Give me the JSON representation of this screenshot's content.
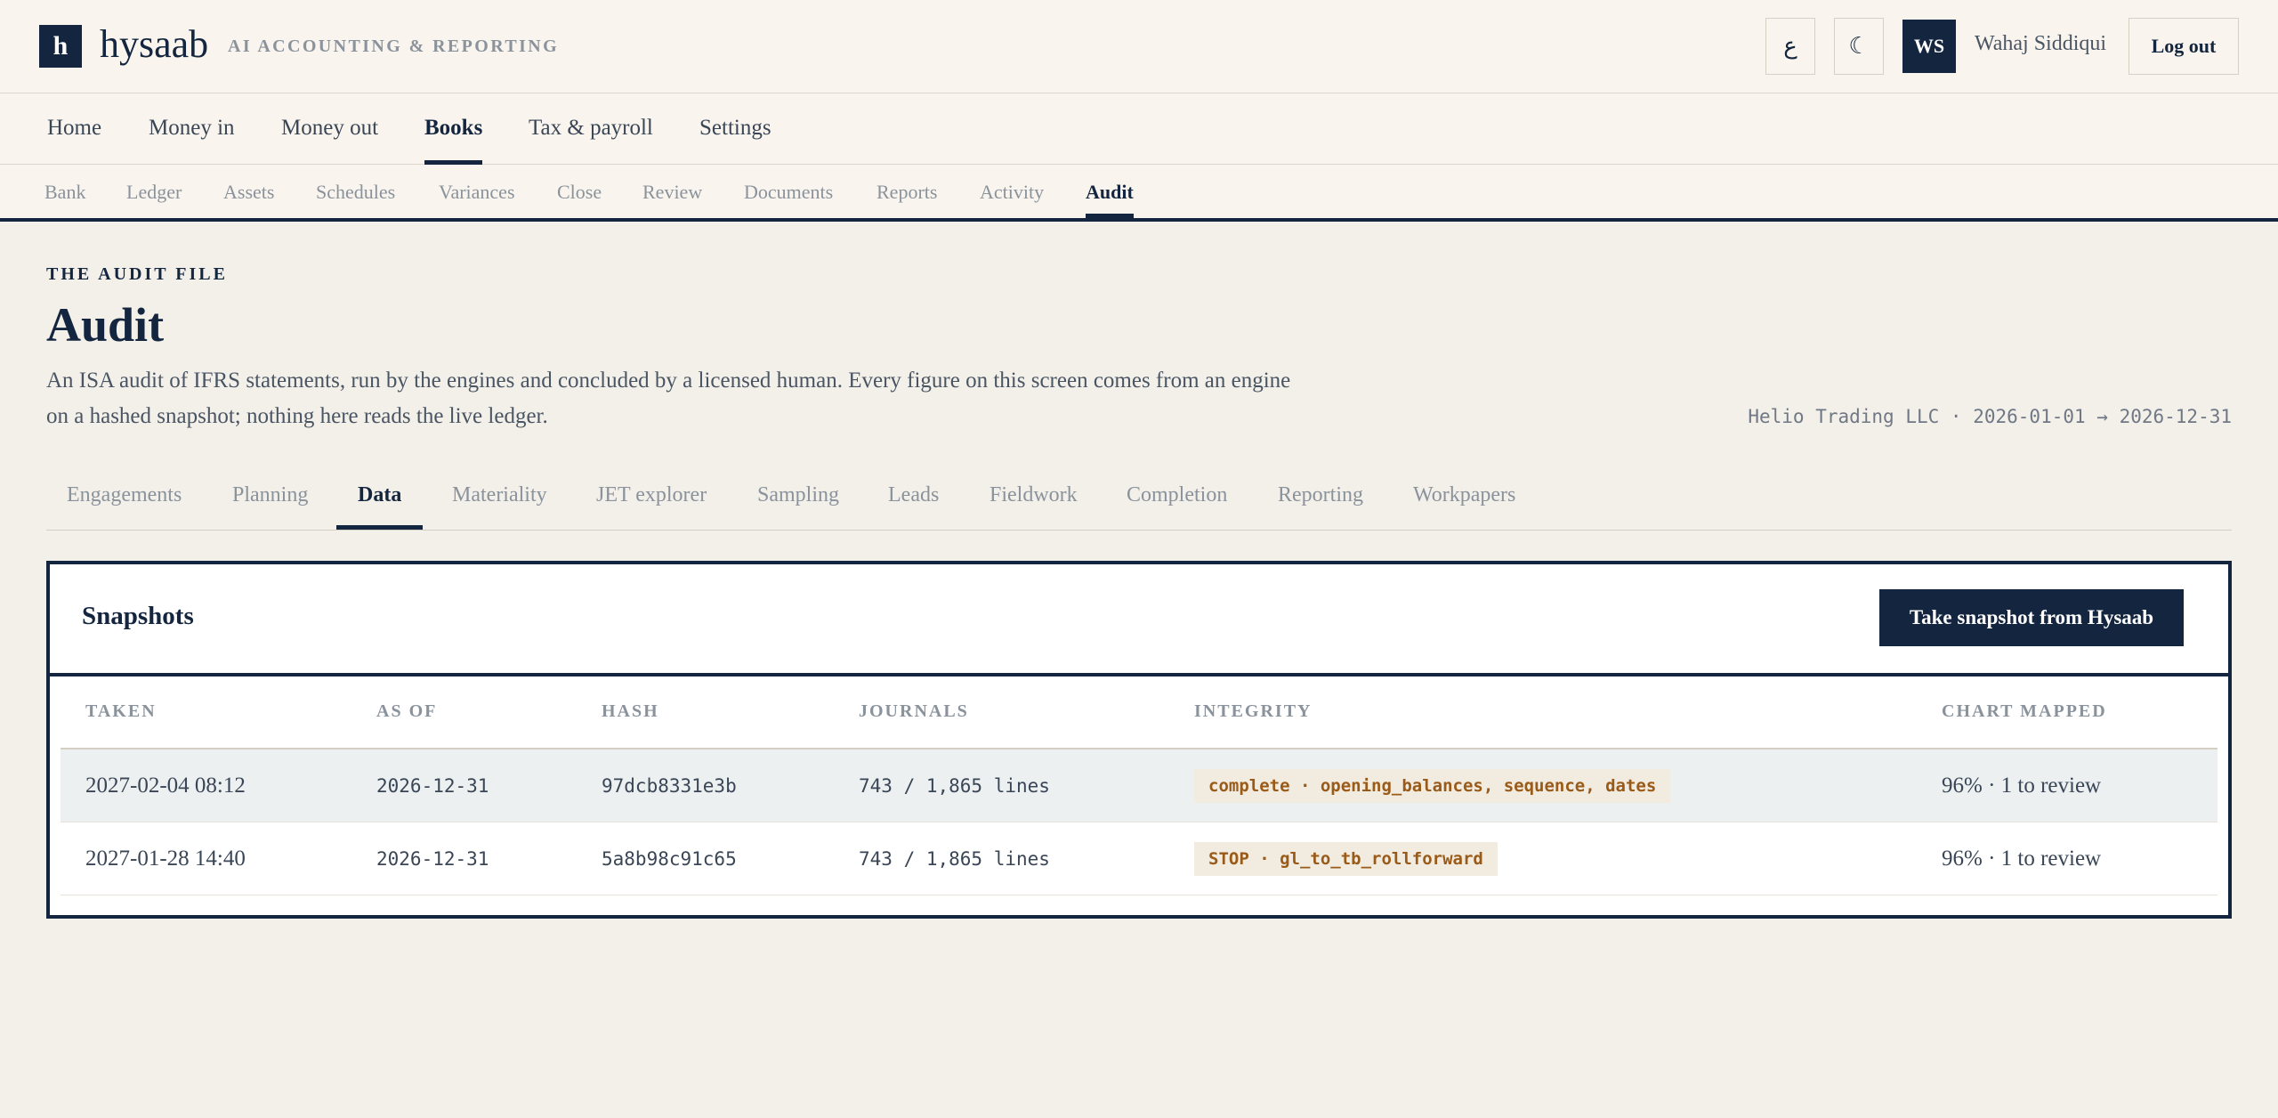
{
  "brand": {
    "mark": "h",
    "name": "hysaab",
    "tagline": "AI ACCOUNTING & REPORTING"
  },
  "header": {
    "lang_button": "ع",
    "lang_button_icon": "arabic-letter-ain-icon",
    "theme_button": "☾",
    "theme_button_icon": "moon-icon",
    "avatar_initials": "WS",
    "user_name": "Wahaj Siddiqui",
    "logout_label": "Log out"
  },
  "primary_nav": {
    "items": [
      {
        "label": "Home"
      },
      {
        "label": "Money in"
      },
      {
        "label": "Money out"
      },
      {
        "label": "Books"
      },
      {
        "label": "Tax & payroll"
      },
      {
        "label": "Settings"
      }
    ],
    "active": "Books"
  },
  "secondary_nav": {
    "items": [
      {
        "label": "Bank"
      },
      {
        "label": "Ledger"
      },
      {
        "label": "Assets"
      },
      {
        "label": "Schedules"
      },
      {
        "label": "Variances"
      },
      {
        "label": "Close"
      },
      {
        "label": "Review"
      },
      {
        "label": "Documents"
      },
      {
        "label": "Reports"
      },
      {
        "label": "Activity"
      },
      {
        "label": "Audit"
      }
    ],
    "active": "Audit"
  },
  "page": {
    "eyebrow": "THE AUDIT FILE",
    "title": "Audit",
    "description": "An ISA audit of IFRS statements, run by the engines and concluded by a licensed human. Every figure on this screen comes from an engine on a hashed snapshot; nothing here reads the live ledger.",
    "context": "Helio Trading LLC · 2026-01-01 → 2026-12-31"
  },
  "audit_tabs": {
    "items": [
      {
        "label": "Engagements"
      },
      {
        "label": "Planning"
      },
      {
        "label": "Data"
      },
      {
        "label": "Materiality"
      },
      {
        "label": "JET explorer"
      },
      {
        "label": "Sampling"
      },
      {
        "label": "Leads"
      },
      {
        "label": "Fieldwork"
      },
      {
        "label": "Completion"
      },
      {
        "label": "Reporting"
      },
      {
        "label": "Workpapers"
      }
    ],
    "active": "Data"
  },
  "snapshots": {
    "title": "Snapshots",
    "take_button": "Take snapshot from Hysaab",
    "columns": [
      "TAKEN",
      "AS OF",
      "HASH",
      "JOURNALS",
      "INTEGRITY",
      "CHART MAPPED"
    ],
    "rows": [
      {
        "taken": "2027-02-04 08:12",
        "as_of": "2026-12-31",
        "hash": "97dcb8331e3b",
        "journals": "743 / 1,865 lines",
        "integrity": "complete · opening_balances, sequence, dates",
        "chart_mapped": "96% · 1 to review"
      },
      {
        "taken": "2027-01-28 14:40",
        "as_of": "2026-12-31",
        "hash": "5a8b98c91c65",
        "journals": "743 / 1,865 lines",
        "integrity": "STOP · gl_to_tb_rollforward",
        "chart_mapped": "96% · 1 to review"
      }
    ]
  },
  "colors": {
    "navy": "#14263f",
    "page_bg": "#f3f0ea",
    "header_bg": "#f9f5ee",
    "warning_text": "#9a5a18",
    "badge_bg": "#f1ebe0",
    "row_highlight": "#ecf0f1"
  }
}
